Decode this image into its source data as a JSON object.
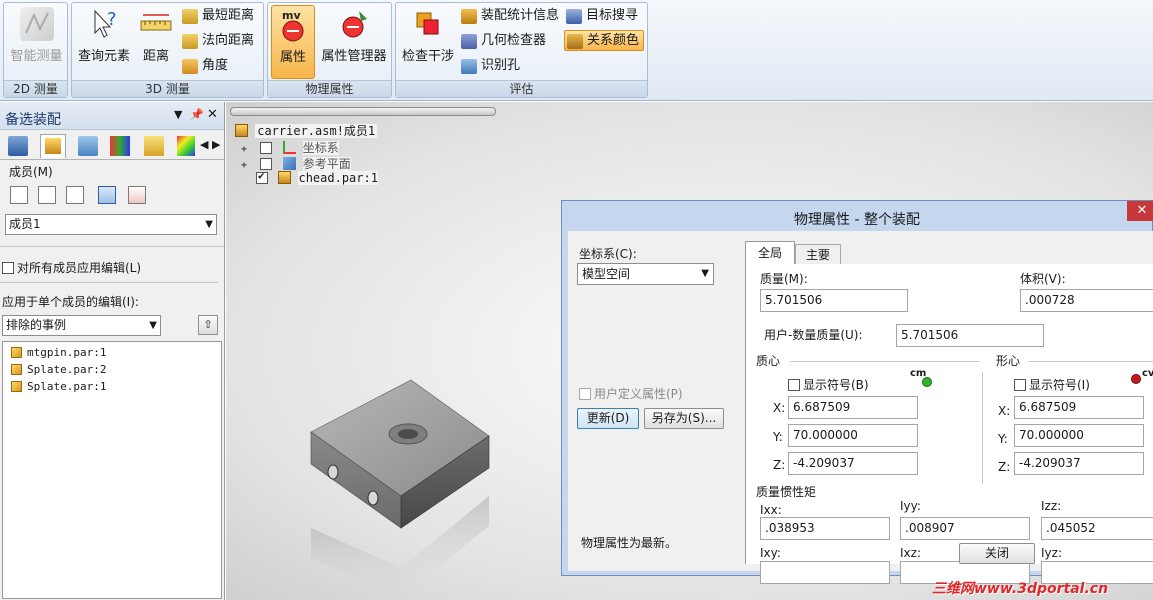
{
  "ribbon": {
    "groups": [
      {
        "label": "2D 测量",
        "big": [
          {
            "label": "智能测量"
          }
        ]
      },
      {
        "label": "3D 测量",
        "big": [
          {
            "label": "查询元素"
          },
          {
            "label": "距离"
          }
        ],
        "small": [
          "最短距离",
          "法向距离",
          "角度"
        ]
      },
      {
        "label": "物理属性",
        "big": [
          {
            "label": "属性",
            "badge": "mv"
          },
          {
            "label": "属性管理器"
          }
        ]
      },
      {
        "label": "评估",
        "big": [
          {
            "label": "检查干涉"
          }
        ],
        "small": [
          "装配统计信息",
          "几何检查器",
          "识别孔",
          "目标搜寻",
          "关系颜色"
        ]
      }
    ]
  },
  "panel": {
    "title": "备选装配",
    "members_label": "成员(M)",
    "member_select": "成员1",
    "apply_all": "对所有成员应用编辑(L)",
    "apply_single": "应用于单个成员的编辑(I):",
    "excluded_select": "排除的事例",
    "parts": [
      "mtgpin.par:1",
      "Splate.par:2",
      "Splate.par:1"
    ]
  },
  "tree": {
    "root": "carrier.asm!成员1",
    "items": [
      {
        "label": "坐标系",
        "checked": false
      },
      {
        "label": "参考平面",
        "checked": false
      },
      {
        "label": "chead.par:1",
        "checked": true
      }
    ]
  },
  "dialog": {
    "title": "物理属性 - 整个装配",
    "coord_label": "坐标系(C):",
    "coord_value": "模型空间",
    "user_defined": "用户定义属性(P)",
    "update_btn": "更新(D)",
    "saveas_btn": "另存为(S)...",
    "status": "物理属性为最新。",
    "tabs": [
      "全局",
      "主要"
    ],
    "mass_label": "质量(M):",
    "mass_value": "5.701506",
    "volume_label": "体积(V):",
    "volume_value": ".000728",
    "user_mass_label": "用户-数量质量(U):",
    "user_mass_value": "5.701506",
    "cm_section": "质心",
    "cv_section": "形心",
    "show_symbol_b": "显示符号(B)",
    "show_symbol_i": "显示符号(I)",
    "cm_tag": "cm",
    "cv_tag": "cv",
    "cm": {
      "x": "6.687509",
      "y": "70.000000",
      "z": "-4.209037"
    },
    "cv": {
      "x": "6.687509",
      "y": "70.000000",
      "z": "-4.209037"
    },
    "axis_x": "X:",
    "axis_y": "Y:",
    "axis_z": "Z:",
    "inertia_label": "质量惯性矩",
    "ixx_label": "Ixx:",
    "ixx": ".038953",
    "iyy_label": "Iyy:",
    "iyy": ".008907",
    "izz_label": "Izz:",
    "izz": ".045052",
    "ixy_label": "Ixy:",
    "ixz_label": "Ixz:",
    "iyz_label": "Iyz:",
    "close_btn": "关闭"
  },
  "watermark": "三维网www.3dportal.cn",
  "colors": {
    "accent": "#f7b54a",
    "dialog_title": "#c4d7ee",
    "close_red": "#c7383a"
  }
}
